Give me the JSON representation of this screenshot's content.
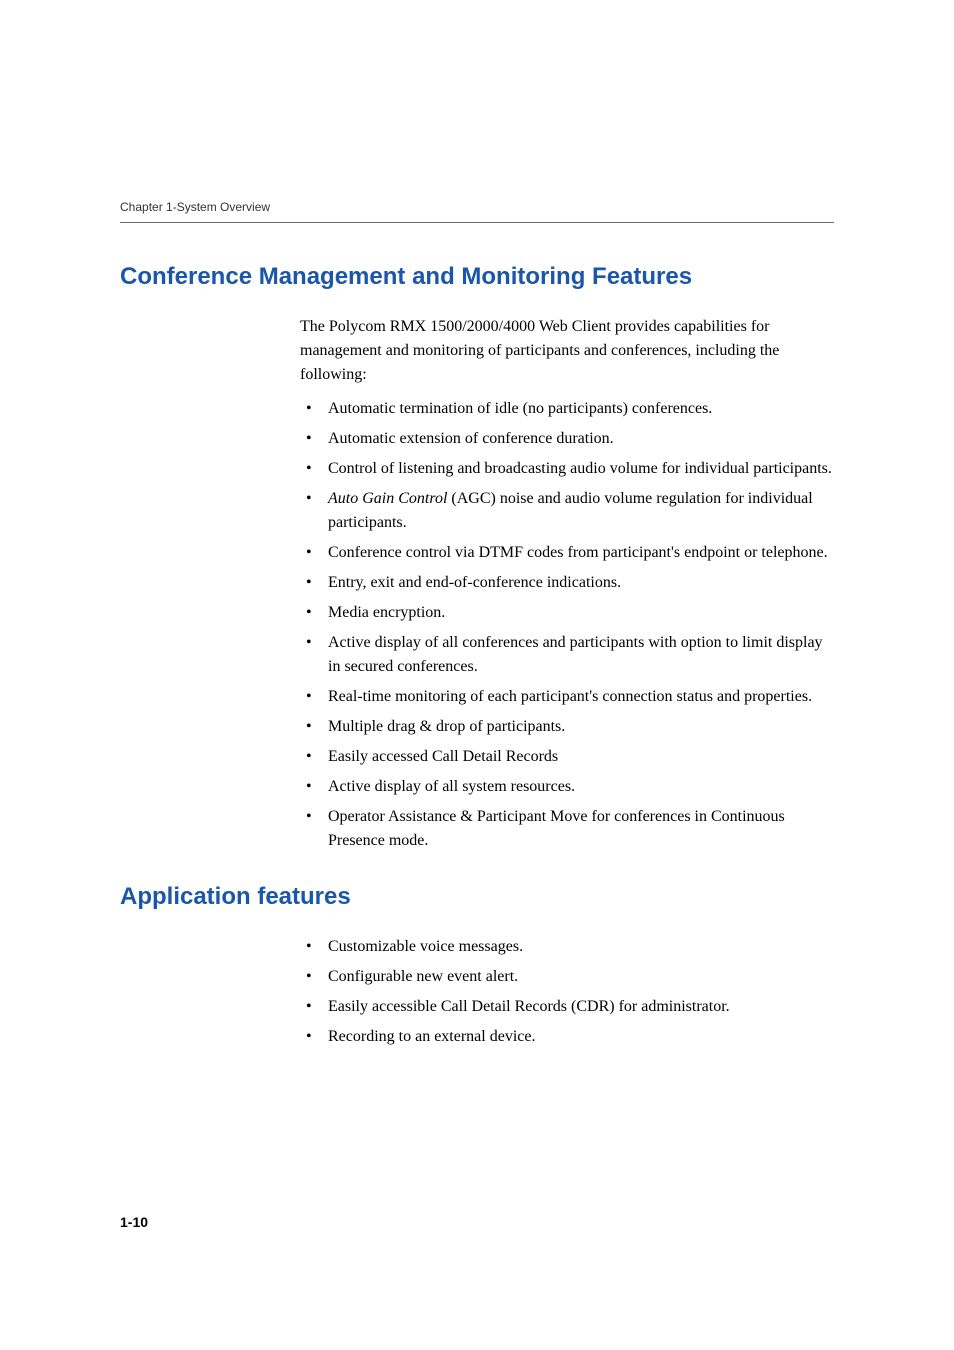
{
  "header": {
    "chapter_line": "Chapter 1-System Overview"
  },
  "sections": [
    {
      "heading": "Conference Management and Monitoring Features",
      "paragraph": "The Polycom RMX 1500/2000/4000 Web Client provides capabilities for management and monitoring of participants and conferences, including the following:",
      "bullets": [
        {
          "text": "Automatic termination of idle (no participants) conferences."
        },
        {
          "text": "Automatic extension of conference duration."
        },
        {
          "text": "Control of listening and broadcasting audio volume for individual participants."
        },
        {
          "italic_prefix": "Auto Gain Control",
          "rest": " (AGC) noise and audio volume regulation for individual participants."
        },
        {
          "text": "Conference control via DTMF codes from participant's endpoint or telephone."
        },
        {
          "text": "Entry, exit and end-of-conference indications."
        },
        {
          "text": "Media encryption."
        },
        {
          "text": "Active display of all conferences and participants with option to limit display in secured conferences."
        },
        {
          "text": "Real-time monitoring of each participant's connection status and properties."
        },
        {
          "text": "Multiple drag & drop of participants."
        },
        {
          "text": "Easily accessed Call Detail Records"
        },
        {
          "text": "Active display of all system resources."
        },
        {
          "text": "Operator Assistance & Participant Move for conferences in Continuous Presence mode."
        }
      ]
    },
    {
      "heading": "Application features",
      "bullets": [
        {
          "text": "Customizable voice messages."
        },
        {
          "text": "Configurable new event alert."
        },
        {
          "text": "Easily accessible Call Detail Records (CDR) for administrator."
        },
        {
          "text": "Recording to an external device."
        }
      ]
    }
  ],
  "page_number": "1-10"
}
